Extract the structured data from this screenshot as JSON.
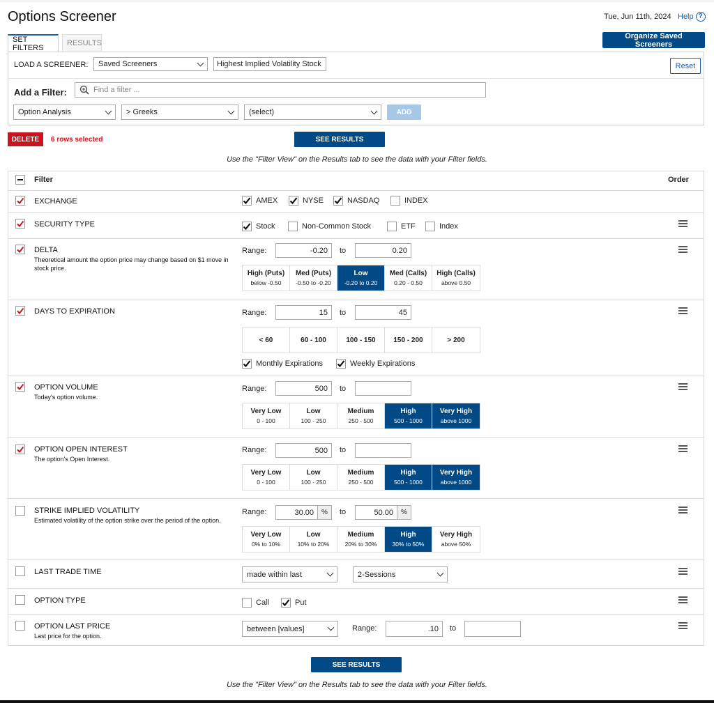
{
  "page": {
    "title": "Options Screener",
    "date": "Tue, Jun 11th, 2024",
    "help_label": "Help",
    "help_symbol": "?"
  },
  "tabs": [
    {
      "label": "SET FILTERS",
      "active": true
    },
    {
      "label": "RESULTS",
      "active": false
    }
  ],
  "organize_button": "Organize Saved Screeners",
  "load": {
    "label": "LOAD A SCREENER:",
    "screener_select": "Saved Screeners",
    "screener_name": "Highest Implied Volatility Stock",
    "reset": "Reset"
  },
  "add_filter": {
    "label": "Add a Filter:",
    "placeholder": "Find a filter ...",
    "category": "Option Analysis",
    "subcategory": "> Greeks",
    "field": "(select)",
    "add": "ADD"
  },
  "actions": {
    "delete": "DELETE",
    "rows_selected": "6 rows selected",
    "see_results": "SEE RESULTS",
    "hint": "Use the \"Filter View\" on the Results tab to see the data with your Filter fields."
  },
  "grid": {
    "filter_header": "Filter",
    "order_header": "Order"
  },
  "rows": {
    "exchange": {
      "title": "EXCHANGE",
      "checked": true,
      "options": [
        {
          "label": "AMEX",
          "checked": true
        },
        {
          "label": "NYSE",
          "checked": true
        },
        {
          "label": "NASDAQ",
          "checked": true
        },
        {
          "label": "INDEX",
          "checked": false
        }
      ]
    },
    "security_type": {
      "title": "SECURITY TYPE",
      "checked": true,
      "options": [
        {
          "label": "Stock",
          "checked": true
        },
        {
          "label": "Non-Common Stock",
          "checked": false
        },
        {
          "label": "ETF",
          "checked": false
        },
        {
          "label": "Index",
          "checked": false
        }
      ]
    },
    "delta": {
      "title": "DELTA",
      "checked": true,
      "desc": "Theoretical amount the option price may change based on $1 move in stock price.",
      "range_label": "Range:",
      "to": "to",
      "from_value": "-0.20",
      "to_value": "0.20",
      "buckets": [
        {
          "top": "High (Puts)",
          "sub": "below -0.50",
          "selected": false
        },
        {
          "top": "Med (Puts)",
          "sub": "-0.50 to -0.20",
          "selected": false
        },
        {
          "top": "Low",
          "sub": "-0.20 to 0.20",
          "selected": true
        },
        {
          "top": "Med (Calls)",
          "sub": "0.20 - 0.50",
          "selected": false
        },
        {
          "top": "High (Calls)",
          "sub": "above 0.50",
          "selected": false
        }
      ]
    },
    "dte": {
      "title": "DAYS TO EXPIRATION",
      "checked": true,
      "range_label": "Range:",
      "to": "to",
      "from_value": "15",
      "to_value": "45",
      "buckets": [
        {
          "top": "< 60"
        },
        {
          "top": "60 - 100"
        },
        {
          "top": "100 - 150"
        },
        {
          "top": "150 - 200"
        },
        {
          "top": "> 200"
        }
      ],
      "monthly": "Monthly Expirations",
      "weekly": "Weekly Expirations"
    },
    "volume": {
      "title": "OPTION VOLUME",
      "checked": true,
      "desc": "Today's option volume.",
      "range_label": "Range:",
      "to": "to",
      "from_value": "500",
      "to_value": "",
      "buckets": [
        {
          "top": "Very Low",
          "sub": "0 - 100",
          "selected": false
        },
        {
          "top": "Low",
          "sub": "100 - 250",
          "selected": false
        },
        {
          "top": "Medium",
          "sub": "250 - 500",
          "selected": false
        },
        {
          "top": "High",
          "sub": "500 - 1000",
          "selected": true
        },
        {
          "top": "Very High",
          "sub": "above 1000",
          "selected": true
        }
      ]
    },
    "open_interest": {
      "title": "OPTION OPEN INTEREST",
      "checked": true,
      "desc": "The option's Open Interest.",
      "range_label": "Range:",
      "to": "to",
      "from_value": "500",
      "to_value": "",
      "buckets": [
        {
          "top": "Very Low",
          "sub": "0 - 100",
          "selected": false
        },
        {
          "top": "Low",
          "sub": "100 - 250",
          "selected": false
        },
        {
          "top": "Medium",
          "sub": "250 - 500",
          "selected": false
        },
        {
          "top": "High",
          "sub": "500 - 1000",
          "selected": true
        },
        {
          "top": "Very High",
          "sub": "above 1000",
          "selected": true
        }
      ]
    },
    "iv": {
      "title": "STRIKE IMPLIED VOLATILITY",
      "checked": false,
      "desc": "Estimated volatility of the option strike over the period of the option.",
      "range_label": "Range:",
      "to": "to",
      "from_value": "30.00",
      "to_value": "50.00",
      "pct": "%",
      "buckets": [
        {
          "top": "Very Low",
          "sub": "0% to 10%",
          "selected": false
        },
        {
          "top": "Low",
          "sub": "10% to 20%",
          "selected": false
        },
        {
          "top": "Medium",
          "sub": "20% to 30%",
          "selected": false
        },
        {
          "top": "High",
          "sub": "30% to 50%",
          "selected": true
        },
        {
          "top": "Very High",
          "sub": "above 50%",
          "selected": false
        }
      ]
    },
    "last_trade": {
      "title": "LAST TRADE TIME",
      "checked": false,
      "mode": "made within last",
      "period": "2-Sessions"
    },
    "option_type": {
      "title": "OPTION TYPE",
      "checked": false,
      "call": "Call",
      "call_checked": false,
      "put": "Put",
      "put_checked": true
    },
    "last_price": {
      "title": "OPTION LAST PRICE",
      "checked": false,
      "desc": "Last price for the option.",
      "mode": "between [values]",
      "range_label": "Range:",
      "to": "to",
      "from_value": ".10",
      "to_value": ""
    }
  },
  "colors": {
    "accent": "#014a86",
    "delete": "#c8141e",
    "check": "#c8141e"
  }
}
